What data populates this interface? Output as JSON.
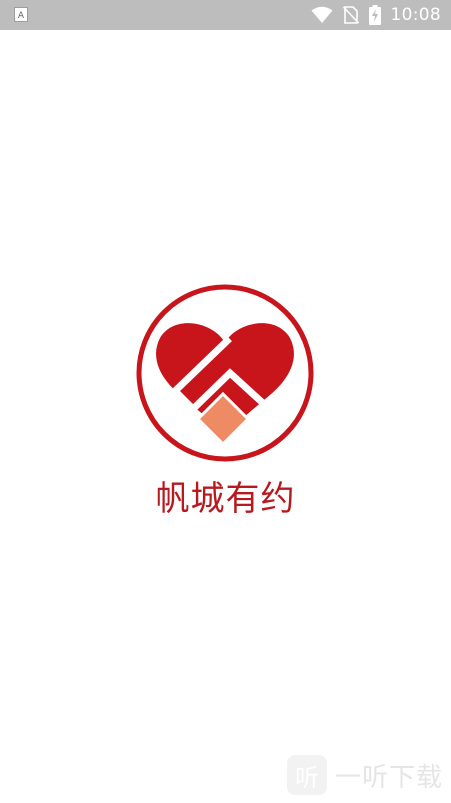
{
  "status_bar": {
    "time": "10:08",
    "icons": [
      "app-notification-icon",
      "wifi-icon",
      "no-sim-icon",
      "battery-charging-icon"
    ]
  },
  "splash": {
    "app_name": "帆城有约",
    "logo": "heart-handshake-logo",
    "colors": {
      "brand_red": "#c8141b",
      "accent_orange": "#ee8a64"
    }
  },
  "watermark": {
    "badge_char": "听",
    "text": "一听下载"
  }
}
